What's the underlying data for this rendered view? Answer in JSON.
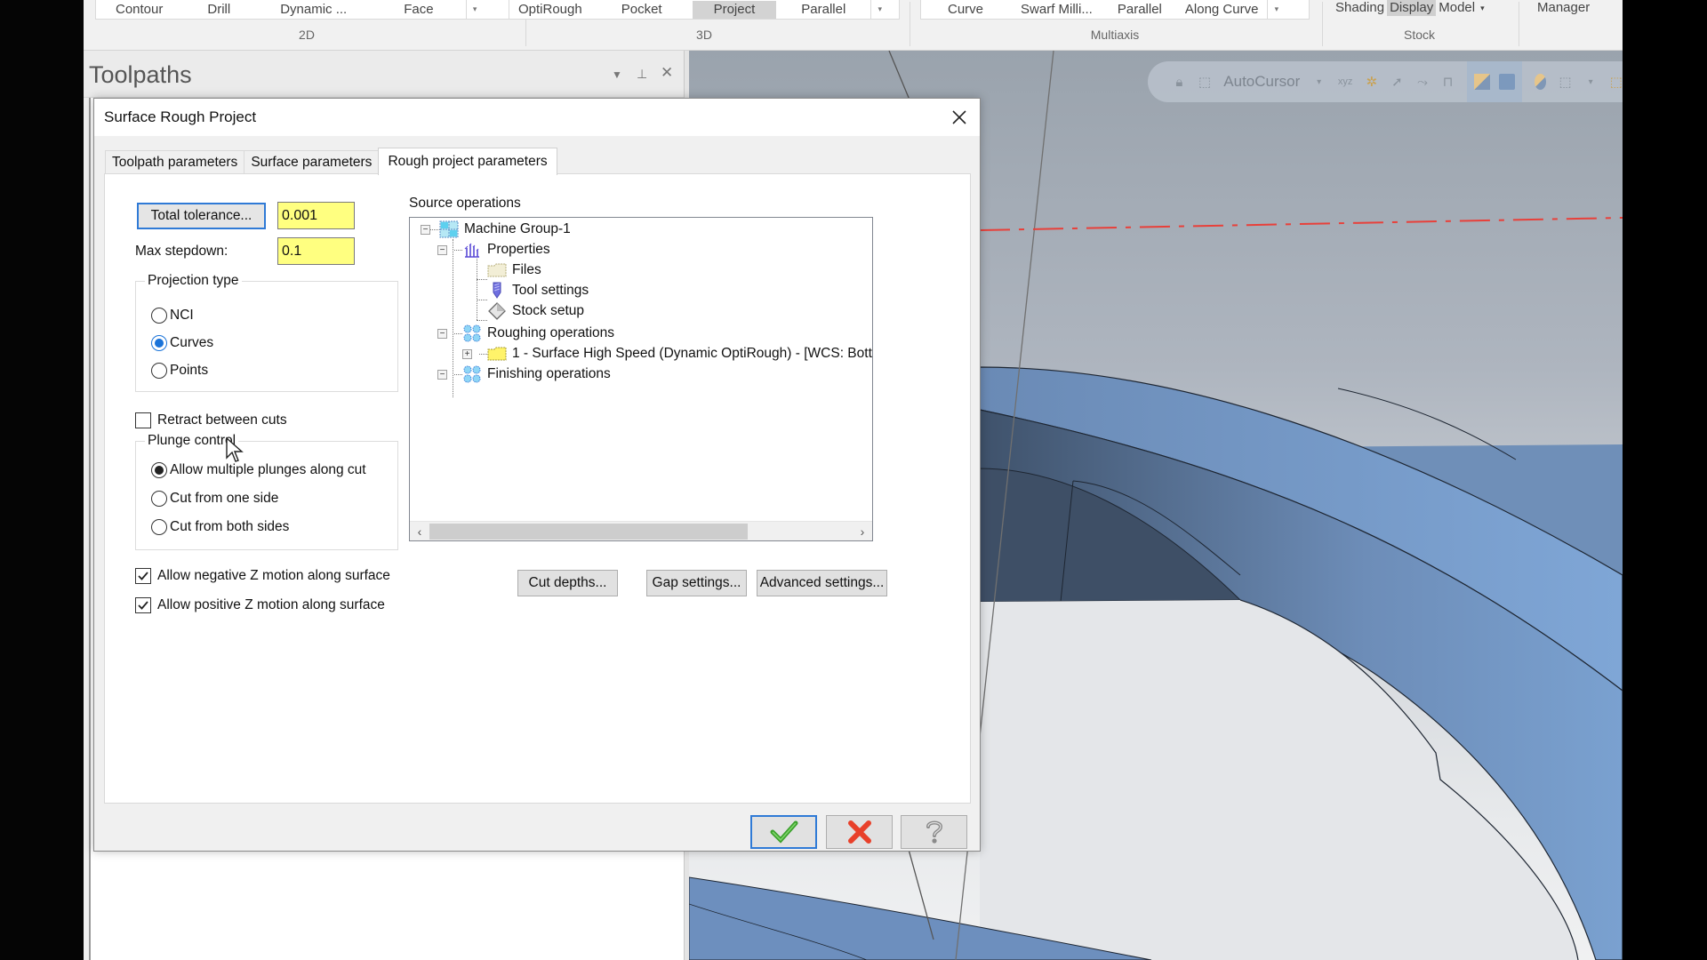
{
  "ribbon": {
    "groups": [
      {
        "label": "2D",
        "buttons": [
          "Contour",
          "Drill",
          "Dynamic ...",
          "Face"
        ],
        "active": null
      },
      {
        "label": "3D",
        "buttons": [
          "OptiRough",
          "Pocket",
          "Project",
          "Parallel"
        ],
        "active": "Project"
      },
      {
        "label": "Multiaxis",
        "buttons": [
          "Curve",
          "Swarf Milli...",
          "Parallel",
          "Along Curve"
        ],
        "active": null
      },
      {
        "label": "Stock",
        "buttons": [
          "Shading",
          "Display",
          "Model"
        ],
        "active": "Display"
      }
    ],
    "manager_label": "Manager"
  },
  "toolpaths_panel": {
    "title": "Toolpaths"
  },
  "viewport": {
    "toolbar": {
      "autocursor_label": "AutoCursor"
    },
    "colors": {
      "part_face": "#6f8fb8",
      "part_dark": "#46586e",
      "axis_line": "#e8403a"
    }
  },
  "dialog": {
    "title": "Surface Rough Project",
    "tabs": [
      {
        "label": "Toolpath parameters",
        "active": false
      },
      {
        "label": "Surface parameters",
        "active": false
      },
      {
        "label": "Rough project parameters",
        "active": true
      }
    ],
    "total_tolerance_button": "Total tolerance...",
    "total_tolerance_value": "0.001",
    "max_stepdown_label": "Max stepdown:",
    "max_stepdown_value": "0.1",
    "projection_type": {
      "title": "Projection type",
      "options": [
        "NCI",
        "Curves",
        "Points"
      ],
      "selected": "Curves"
    },
    "retract_between_cuts": {
      "label": "Retract between cuts",
      "checked": false
    },
    "plunge_control": {
      "title": "Plunge control",
      "options": [
        "Allow multiple plunges along cut",
        "Cut from one side",
        "Cut from both sides"
      ],
      "selected": "Allow multiple plunges along cut"
    },
    "allow_negative_z": {
      "label": "Allow negative Z motion along surface",
      "checked": true
    },
    "allow_positive_z": {
      "label": "Allow positive Z motion along surface",
      "checked": true
    },
    "source_operations": {
      "label": "Source operations",
      "tree": [
        {
          "label": "Machine Group-1",
          "icon": "machine-group-icon",
          "expanded": true
        },
        {
          "label": "Properties",
          "icon": "properties-icon",
          "expanded": true
        },
        {
          "label": "Files",
          "icon": "files-folder-icon"
        },
        {
          "label": "Tool settings",
          "icon": "tool-settings-icon"
        },
        {
          "label": "Stock setup",
          "icon": "stock-setup-icon"
        },
        {
          "label": "Roughing operations",
          "icon": "operations-group-icon",
          "expanded": true
        },
        {
          "label": "1 - Surface High Speed (Dynamic OptiRough) - [WCS: Bott",
          "icon": "operation-folder-icon",
          "expanded": false
        },
        {
          "label": "Finishing operations",
          "icon": "operations-group-icon",
          "expanded": true
        }
      ]
    },
    "buttons": {
      "cut_depths": "Cut depths...",
      "gap_settings": "Gap settings...",
      "advanced_settings": "Advanced settings..."
    },
    "footer": {
      "ok": "OK",
      "cancel": "Cancel",
      "help": "Help"
    }
  }
}
